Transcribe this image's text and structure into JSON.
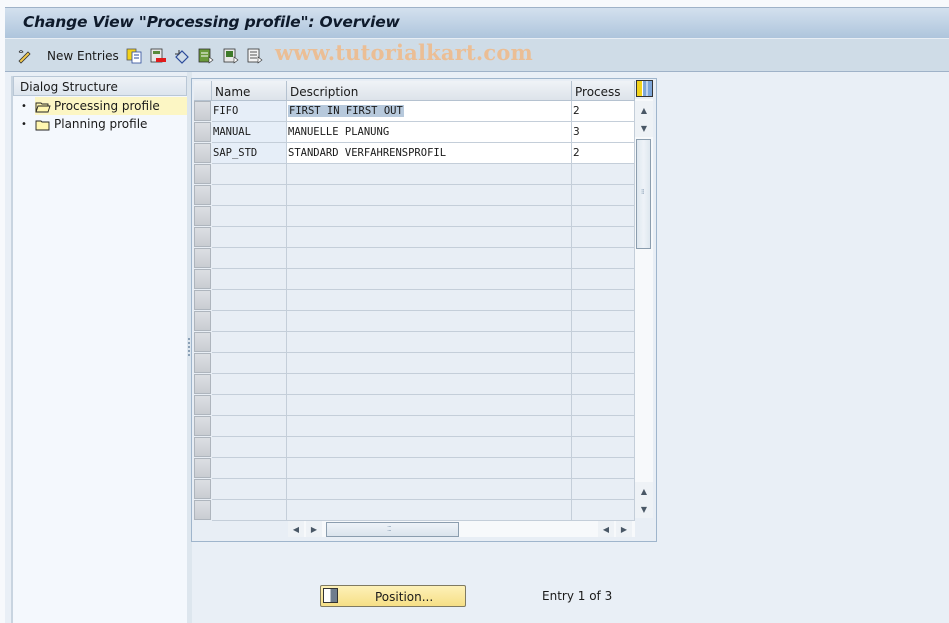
{
  "window": {
    "title": "Change View \"Processing profile\": Overview"
  },
  "toolbar": {
    "items": [
      {
        "name": "display-change-icon",
        "label": ""
      },
      {
        "name": "new-entries-button",
        "label": "New Entries"
      },
      {
        "name": "copy-as-icon",
        "label": ""
      },
      {
        "name": "delete-icon",
        "label": ""
      },
      {
        "name": "undo-change-icon",
        "label": ""
      },
      {
        "name": "select-all-icon",
        "label": ""
      },
      {
        "name": "select-block-icon",
        "label": ""
      },
      {
        "name": "deselect-all-icon",
        "label": ""
      }
    ],
    "watermark": "www.tutorialkart.com"
  },
  "dialog_structure": {
    "header": "Dialog Structure",
    "items": [
      {
        "label": "Processing profile",
        "selected": true,
        "icon": "open-folder-icon"
      },
      {
        "label": "Planning profile",
        "selected": false,
        "icon": "folder-icon"
      }
    ]
  },
  "table": {
    "columns": [
      "Name",
      "Description",
      "Process"
    ],
    "rows": [
      {
        "name": "FIFO",
        "description": "FIRST IN FIRST OUT",
        "process": "2"
      },
      {
        "name": "MANUAL",
        "description": "MANUELLE PLANUNG",
        "process": "3"
      },
      {
        "name": "SAP_STD",
        "description": "STANDARD VERFAHRENSPROFIL",
        "process": "2"
      }
    ],
    "selected_cell": "FIRST IN FIRST OUT"
  },
  "footer": {
    "position_button": "Position...",
    "entry_info": "Entry 1 of 3"
  },
  "colors": {
    "title_bar": "#aec5dc",
    "toolbar": "#cfdce7",
    "selected_tree_item": "#fcf6c4",
    "position_button": "#f6df86",
    "watermark": "#f0b987"
  }
}
